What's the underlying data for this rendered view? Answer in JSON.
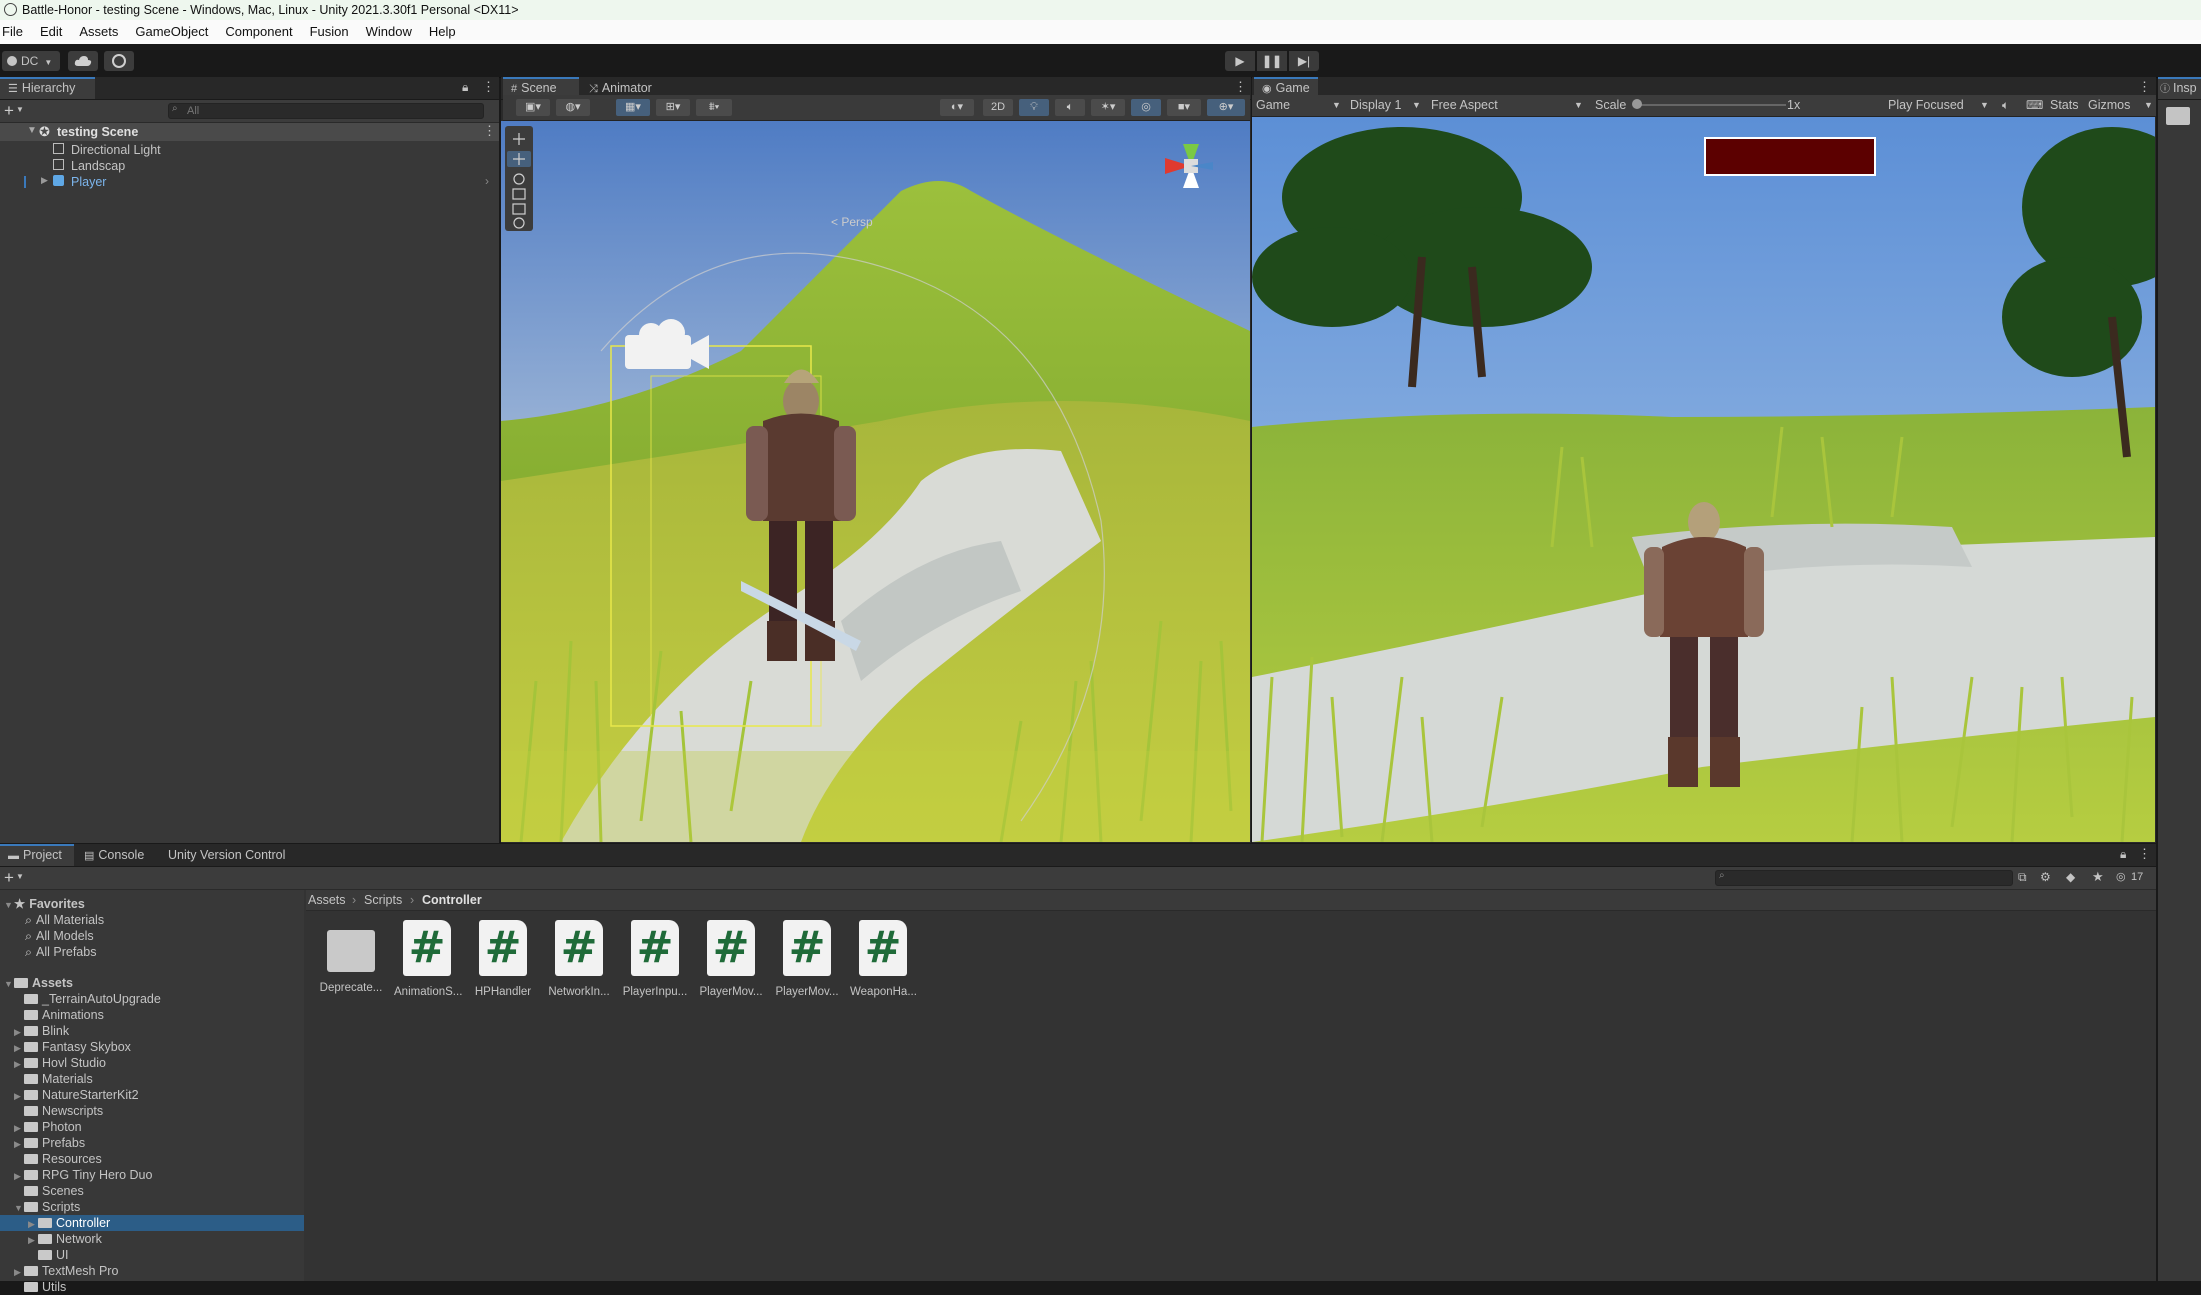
{
  "window": {
    "title": "Battle-Honor - testing Scene - Windows, Mac, Linux - Unity 2021.3.30f1 Personal <DX11>"
  },
  "menu": [
    "File",
    "Edit",
    "Assets",
    "GameObject",
    "Component",
    "Fusion",
    "Window",
    "Help"
  ],
  "toolbar": {
    "account": "DC",
    "play_icons": [
      "play-icon",
      "pause-icon",
      "step-icon"
    ]
  },
  "hierarchy": {
    "tab": "Hierarchy",
    "search_placeholder": "All",
    "scene": "testing Scene",
    "items": [
      "Directional Light",
      "Landscap",
      "Player"
    ]
  },
  "scene_view": {
    "tabs": [
      "Scene",
      "Animator"
    ],
    "mode_2d": "2D",
    "persp_label": "< Persp",
    "tools": [
      "hand-tool",
      "move-tool",
      "rotate-tool",
      "scale-tool",
      "rect-tool",
      "transform-tool"
    ]
  },
  "game_view": {
    "tab": "Game",
    "game_label": "Game",
    "display": "Display 1",
    "aspect": "Free Aspect",
    "scale_label": "Scale",
    "scale_value": "1x",
    "play_focused": "Play Focused",
    "stats": "Stats",
    "gizmos": "Gizmos",
    "health_bar_color": "#5c0000"
  },
  "inspector": {
    "tab": "Insp"
  },
  "project": {
    "tabs": [
      "Project",
      "Console",
      "Unity Version Control"
    ],
    "hidden_count": "17",
    "breadcrumb": [
      "Assets",
      "Scripts",
      "Controller"
    ],
    "favorites_label": "Favorites",
    "favorites": [
      "All Materials",
      "All Models",
      "All Prefabs"
    ],
    "assets_label": "Assets",
    "folders": [
      "_TerrainAutoUpgrade",
      "Animations",
      "Blink",
      "Fantasy Skybox",
      "Hovl Studio",
      "Materials",
      "NatureStarterKit2",
      "Newscripts",
      "Photon",
      "Prefabs",
      "Resources",
      "RPG Tiny Hero Duo",
      "Scenes",
      "Scripts",
      "Controller",
      "Network",
      "UI",
      "TextMesh Pro",
      "Utils"
    ],
    "files": [
      "Deprecate...",
      "AnimationS...",
      "HPHandler",
      "NetworkIn...",
      "PlayerInpu...",
      "PlayerMov...",
      "PlayerMov...",
      "WeaponHa..."
    ],
    "script_glyph": "#"
  },
  "colors": {
    "accent": "#3a79bb",
    "selection": "#2c5d87",
    "panel": "#383838",
    "dark": "#191919"
  }
}
